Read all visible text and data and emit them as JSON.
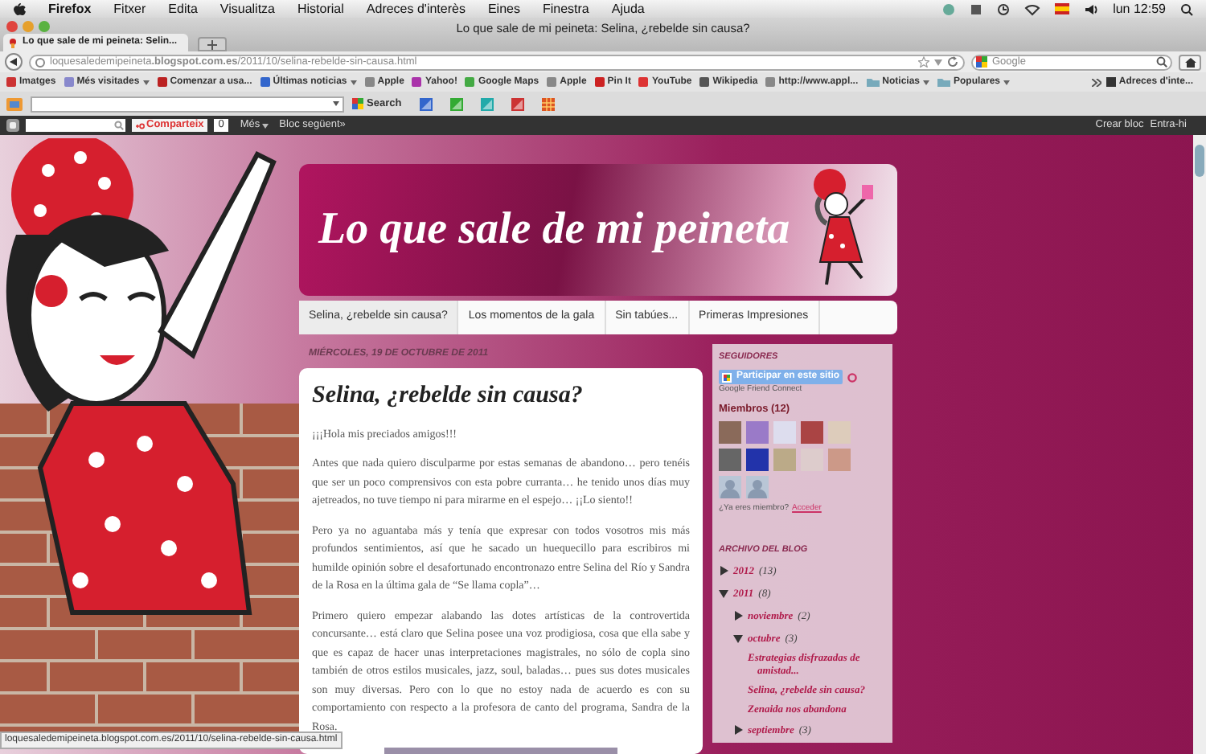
{
  "menubar": {
    "items": [
      "Firefox",
      "Fitxer",
      "Edita",
      "Visualitza",
      "Historial",
      "Adreces d'interès",
      "Eines",
      "Finestra",
      "Ajuda"
    ],
    "clock": "lun 12:59"
  },
  "window": {
    "title": "Lo que sale de mi peineta: Selina, ¿rebelde sin causa?"
  },
  "tabs": [
    {
      "label": "Lo que sale de mi peineta: Selin...",
      "selected": true
    }
  ],
  "address_bar": {
    "url": "loquesaledemipeineta**.blogspot.com.es**/2011/10/selina-rebelde-sin-causa.html"
  },
  "search_field": {
    "placeholder": "Google"
  },
  "bookmarks": [
    {
      "label": "Imatges",
      "kind": "link",
      "dropdown": false
    },
    {
      "label": "Més visitades",
      "kind": "link",
      "dropdown": true
    },
    {
      "label": "Comenzar a usa...",
      "kind": "link",
      "dropdown": false
    },
    {
      "label": "Últimas noticias",
      "kind": "link",
      "dropdown": true
    },
    {
      "label": "Apple",
      "kind": "link",
      "dropdown": false
    },
    {
      "label": "Yahoo!",
      "kind": "link",
      "dropdown": false
    },
    {
      "label": "Google Maps",
      "kind": "link",
      "dropdown": false
    },
    {
      "label": "Apple",
      "kind": "link",
      "dropdown": false
    },
    {
      "label": "Pin It",
      "kind": "link",
      "dropdown": false
    },
    {
      "label": "YouTube",
      "kind": "link",
      "dropdown": false
    },
    {
      "label": "Wikipedia",
      "kind": "link",
      "dropdown": false
    },
    {
      "label": "http://www.appl...",
      "kind": "link",
      "dropdown": false
    },
    {
      "label": "Noticias",
      "kind": "folder",
      "dropdown": true
    },
    {
      "label": "Populares",
      "kind": "folder",
      "dropdown": true
    }
  ],
  "bookmarks_overflow": {
    "label": "Adreces d'inte..."
  },
  "toolbar": {
    "search_label": "Search"
  },
  "blogger_bar": {
    "share": "Comparteix",
    "share_count": "0",
    "more": "Més",
    "next_blog": "Bloc següent»",
    "create": "Crear bloc",
    "sign_in": "Entra-hi"
  },
  "blog": {
    "title": "Lo que sale de mi peineta",
    "pages": [
      {
        "label": "Selina, ¿rebelde sin causa?",
        "selected": true
      },
      {
        "label": "Los momentos de la gala",
        "selected": false
      },
      {
        "label": "Sin tabúes...",
        "selected": false
      },
      {
        "label": "Primeras Impresiones",
        "selected": false
      }
    ]
  },
  "post": {
    "date": "MIÉRCOLES, 19 DE OCTUBRE DE 2011",
    "title": "Selina, ¿rebelde sin causa?",
    "paragraphs": [
      "¡¡¡Hola mis preciados amigos!!!",
      "Antes que nada quiero disculparme por estas semanas de abandono… pero tenéis que ser un poco comprensivos con esta pobre curranta… he tenido unos días muy ajetreados, no tuve tiempo ni para mirarme en el espejo… ¡¡Lo siento!!",
      "Pero ya no aguantaba más y tenía que expresar con todos vosotros mis más profundos sentimientos, así que he sacado un huequecillo para escribiros mi humilde opinión sobre el desafortunado encontronazo entre Selina del Río y Sandra de la Rosa en la última gala de “Se llama copla”…",
      "Primero quiero empezar alabando las dotes artísticas de la controvertida concursante… está claro que Selina posee una voz prodigiosa, cosa que ella sabe y que es capaz de hacer unas interpretaciones magistrales, no sólo de copla sino también de otros estilos musicales, jazz, soul, baladas… pues sus dotes musicales son muy diversas. Pero con lo que no estoy nada de acuerdo es con su comportamiento con respecto a la profesora de canto del programa, Sandra de la Rosa."
    ]
  },
  "followers": {
    "heading": "SEGUIDORES",
    "join_button": "Participar en este sitio",
    "provider": "Google Friend Connect",
    "members_heading": "Miembros (12)",
    "members": [
      {
        "kind": "photo"
      },
      {
        "kind": "photo"
      },
      {
        "kind": "photo"
      },
      {
        "kind": "photo"
      },
      {
        "kind": "photo"
      },
      {
        "kind": "photo"
      },
      {
        "kind": "photo"
      },
      {
        "kind": "photo"
      },
      {
        "kind": "photo"
      },
      {
        "kind": "photo"
      },
      {
        "kind": "silhouette"
      },
      {
        "kind": "silhouette"
      }
    ],
    "member_prompt": "¿Ya eres miembro?",
    "sign_in_link": "Acceder"
  },
  "archive": {
    "heading": "ARCHIVO DEL BLOG",
    "items": [
      {
        "kind": "year",
        "label": "2012",
        "count": "(13)",
        "expanded": false
      },
      {
        "kind": "year",
        "label": "2011",
        "count": "(8)",
        "expanded": true,
        "children": [
          {
            "kind": "month",
            "label": "noviembre",
            "count": "(2)",
            "expanded": false
          },
          {
            "kind": "month",
            "label": "octubre",
            "count": "(3)",
            "expanded": true,
            "children": [
              {
                "kind": "post",
                "label": "Estrategias disfrazadas de amistad..."
              },
              {
                "kind": "post",
                "label": "Selina, ¿rebelde sin causa?"
              },
              {
                "kind": "post",
                "label": "Zenaida nos abandona"
              }
            ]
          },
          {
            "kind": "month",
            "label": "septiembre",
            "count": "(3)",
            "expanded": false
          }
        ]
      }
    ]
  },
  "status_bar": {
    "url": "loquesaledemipeineta.blogspot.com.es/2011/10/selina-rebelde-sin-causa.html"
  }
}
